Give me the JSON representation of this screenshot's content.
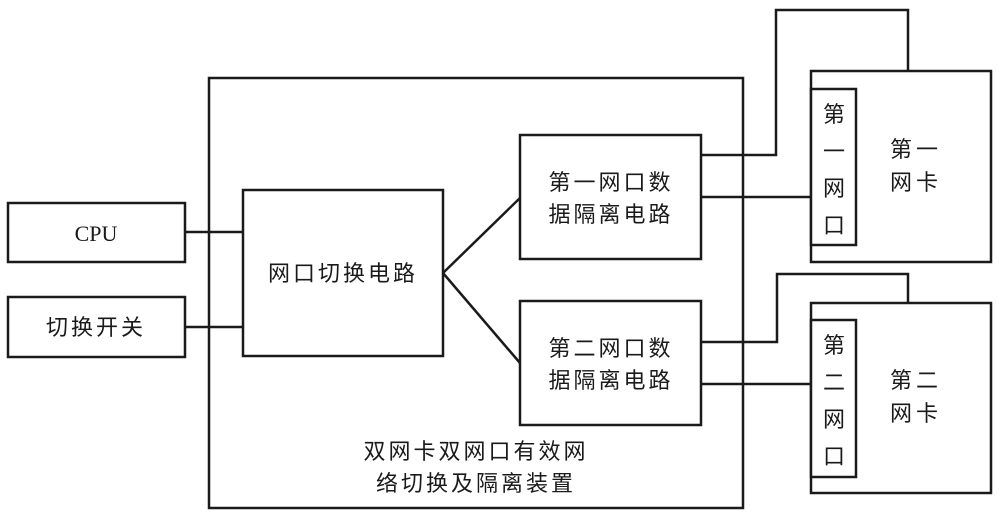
{
  "diagram": {
    "type": "block-diagram",
    "nodes": {
      "cpu": {
        "label": "CPU"
      },
      "switch": {
        "label": "切换开关"
      },
      "device": {
        "label_lines": [
          "双网卡双网口有效网",
          "络切换及隔离装置"
        ]
      },
      "port_switch_circuit": {
        "label": "网口切换电路"
      },
      "isolation_1": {
        "label_lines": [
          "第一网口数",
          "据隔离电路"
        ]
      },
      "isolation_2": {
        "label_lines": [
          "第二网口数",
          "据隔离电路"
        ]
      },
      "nic_1": {
        "label_lines": [
          "第一",
          "网卡"
        ]
      },
      "nic_2": {
        "label_lines": [
          "第二",
          "网卡"
        ]
      },
      "port_1": {
        "label_chars": [
          "第",
          "一",
          "网",
          "口"
        ]
      },
      "port_2": {
        "label_chars": [
          "第",
          "二",
          "网",
          "口"
        ]
      }
    },
    "edges": [
      {
        "from": "cpu",
        "to": "port_switch_circuit"
      },
      {
        "from": "switch",
        "to": "port_switch_circuit"
      },
      {
        "from": "port_switch_circuit",
        "to": "isolation_1"
      },
      {
        "from": "port_switch_circuit",
        "to": "isolation_2"
      },
      {
        "from": "isolation_1",
        "to": "nic_1"
      },
      {
        "from": "isolation_1",
        "to": "port_1"
      },
      {
        "from": "isolation_2",
        "to": "nic_2"
      },
      {
        "from": "isolation_2",
        "to": "port_2"
      }
    ]
  }
}
